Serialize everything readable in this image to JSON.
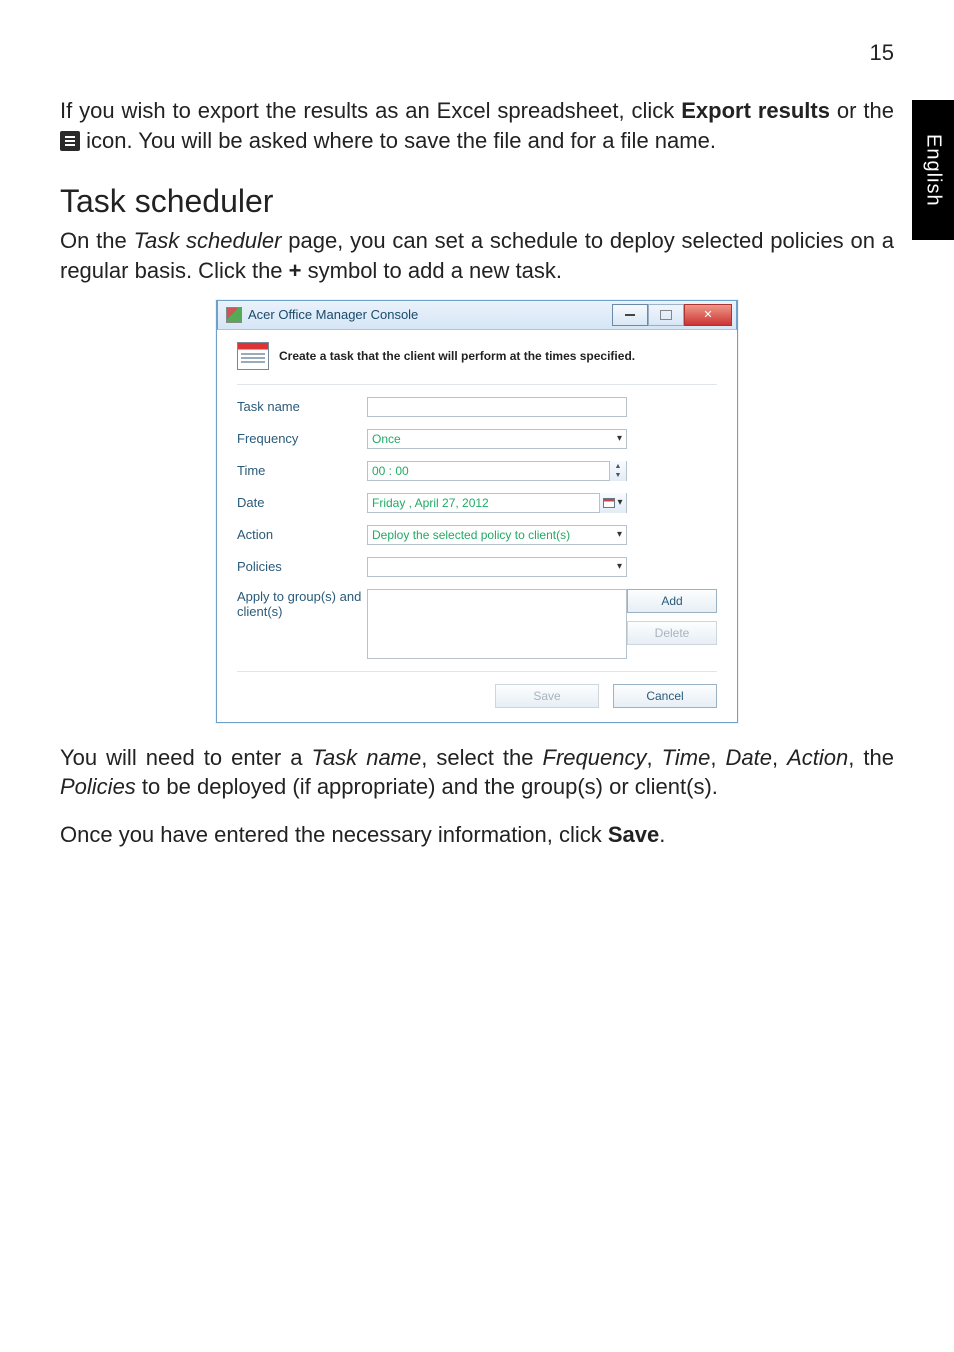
{
  "page_number": "15",
  "side_tab": "English",
  "para1": {
    "pre": "If you wish to export the results as an Excel spreadsheet, click ",
    "bold1": "Export results",
    "mid": " or the ",
    "after_icon": " icon. You will be asked where to save the file and for a file name."
  },
  "heading": "Task scheduler",
  "para2": {
    "pre": "On the ",
    "it1": "Task scheduler",
    "mid": " page, you can set a schedule to deploy selected policies on a regular basis. Click the ",
    "bold_plus": "+",
    "after": " symbol to add a new task."
  },
  "dialog": {
    "title": "Acer Office Manager Console",
    "header_text": "Create a task that the client will perform at the times specified.",
    "labels": {
      "task_name": "Task name",
      "frequency": "Frequency",
      "time": "Time",
      "date": "Date",
      "action": "Action",
      "policies": "Policies",
      "apply": "Apply to group(s) and client(s)"
    },
    "values": {
      "frequency": "Once",
      "time": "00 : 00",
      "date": "Friday   ,    April    27, 2012",
      "action": "Deploy the selected policy to client(s)"
    },
    "buttons": {
      "add": "Add",
      "delete": "Delete",
      "save": "Save",
      "cancel": "Cancel"
    }
  },
  "para3": {
    "pre": "You will need to enter a ",
    "it1": "Task name",
    "s1": ", select the ",
    "it2": "Frequency",
    "s2": ", ",
    "it3": "Time",
    "s3": ", ",
    "it4": "Date",
    "s4": ", ",
    "it5": "Action",
    "s5": ", the ",
    "it6": "Policies",
    "after": " to be deployed (if appropriate) and the group(s) or client(s)."
  },
  "para4": {
    "pre": "Once you have entered the necessary information, click ",
    "bold": "Save",
    "after": "."
  }
}
